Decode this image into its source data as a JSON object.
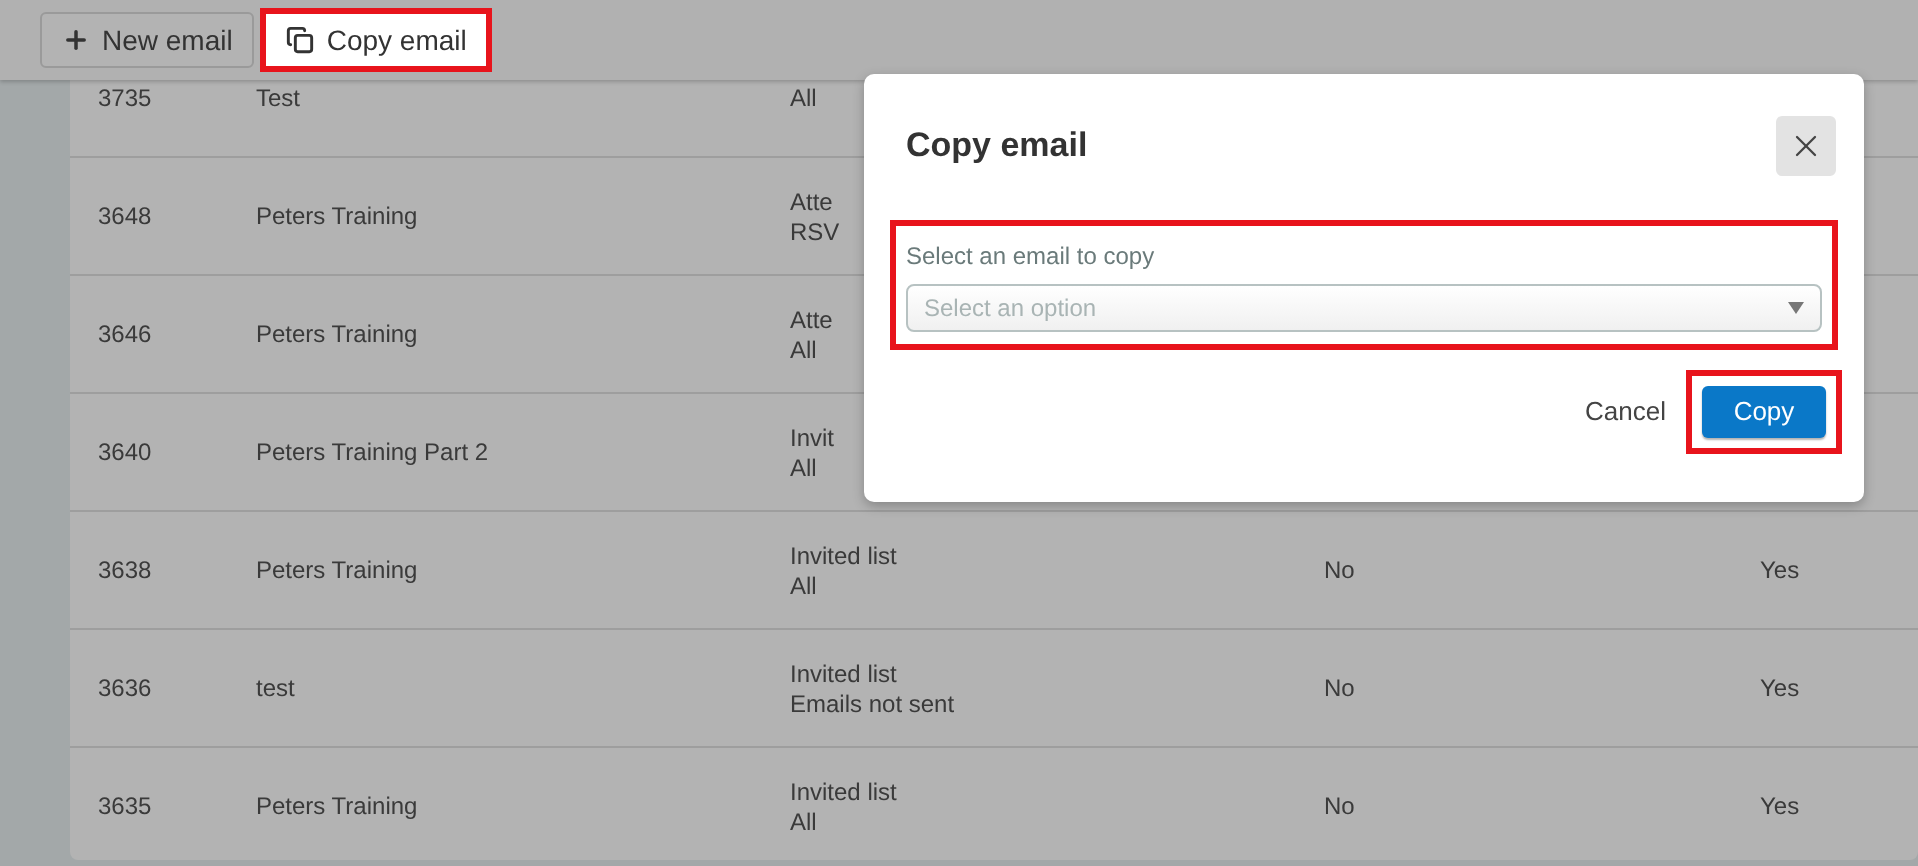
{
  "toolbar": {
    "buttons": [
      {
        "label": "New email",
        "highlighted": false
      },
      {
        "label": "Copy email",
        "highlighted": true
      }
    ]
  },
  "table": {
    "rows": [
      {
        "id": "3735",
        "name": "Test",
        "list": [
          "All"
        ]
      },
      {
        "id": "3648",
        "name": "Peters Training",
        "list": [
          "Atte",
          "RSV"
        ]
      },
      {
        "id": "3646",
        "name": "Peters Training",
        "list": [
          "Atte",
          "All"
        ]
      },
      {
        "id": "3640",
        "name": "Peters Training Part 2",
        "list": [
          "Invit",
          "All"
        ]
      },
      {
        "id": "3638",
        "name": "Peters Training",
        "list": [
          "Invited list",
          "All"
        ],
        "column_4": "No",
        "column_5": "Yes"
      },
      {
        "id": "3636",
        "name": "test",
        "list": [
          "Invited list",
          "Emails not sent"
        ],
        "column_4": "No",
        "column_5": "Yes"
      },
      {
        "id": "3635",
        "name": "Peters Training",
        "list": [
          "Invited list",
          "All"
        ],
        "column_4": "No",
        "column_5": "Yes"
      }
    ]
  },
  "dialog": {
    "title": "Copy email",
    "field": {
      "label": "Select an email to copy",
      "placeholder": "Select an option",
      "highlighted": true
    },
    "cancel": "Cancel",
    "confirm": {
      "label": "Copy",
      "highlighted": true
    }
  }
}
